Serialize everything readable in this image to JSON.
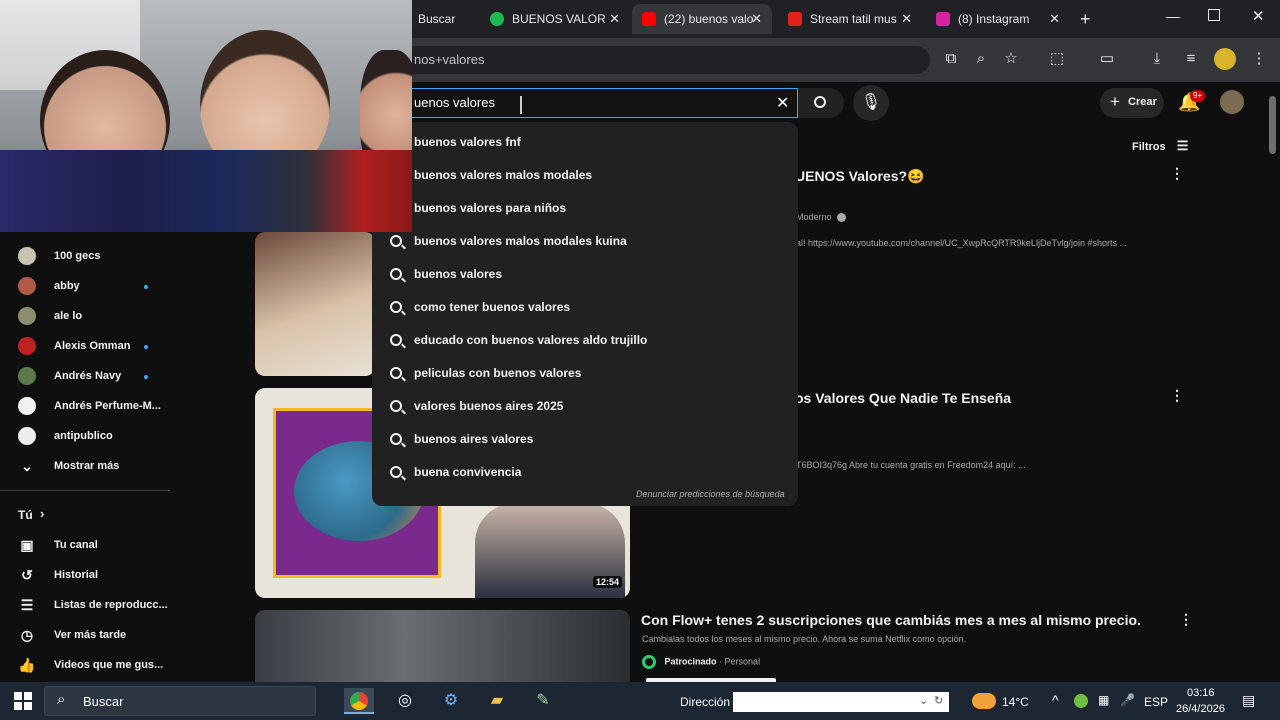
{
  "browser": {
    "tabs": [
      {
        "label": "Buscar",
        "color": "#4285f4"
      },
      {
        "label": "BUENOS VALOR",
        "color": "#1db954"
      },
      {
        "label": "(22) buenos valo",
        "color": "#ff0000"
      },
      {
        "label": "Stream tatil mus",
        "color": "#e62117"
      },
      {
        "label": "(8) Instagram",
        "color": "#d6249f"
      }
    ],
    "new_tab": "+",
    "address": "nos+valores",
    "window_controls": [
      "minimize",
      "maximize",
      "close"
    ]
  },
  "youtube": {
    "search_value": "uenos valores",
    "suggestions": [
      "buenos valores fnf",
      "buenos valores malos modales",
      "buenos valores para niños",
      "buenos valores malos modales kuina",
      "buenos valores",
      "como tener buenos valores",
      "educado con buenos valores aldo trujillo",
      "peliculas con buenos valores",
      "valores buenos aires 2025",
      "buenos aires valores",
      "buena convivencia"
    ],
    "report_text": "Denunciar predicciones de búsqueda",
    "create_label": "Crear",
    "notif_badge": "9+",
    "filters_label": "Filtros"
  },
  "sidebar": {
    "subscriptions": [
      {
        "name": "100 gecs",
        "color": "#c9c3b0",
        "dot": false
      },
      {
        "name": "abby",
        "color": "#b05a46",
        "dot": true
      },
      {
        "name": "ale lo",
        "color": "#8c8f6e",
        "dot": false
      },
      {
        "name": "Alexis Omman",
        "color": "#c02020",
        "dot": true
      },
      {
        "name": "Andrés Navy",
        "color": "#5b7a4a",
        "dot": true
      },
      {
        "name": "Andrés Perfume-M...",
        "color": "#f1f1f1",
        "dot": false
      },
      {
        "name": "antipublico",
        "color": "#eeeeee",
        "dot": false
      }
    ],
    "show_more": "Mostrar más",
    "you_section": "Tú",
    "you_items": [
      {
        "label": "Tu canal",
        "icon": "user-square-icon"
      },
      {
        "label": "Historial",
        "icon": "history-icon"
      },
      {
        "label": "Listas de reproducc...",
        "icon": "playlist-icon"
      },
      {
        "label": "Ver más tarde",
        "icon": "clock-icon"
      },
      {
        "label": "Videos que me gus...",
        "icon": "thumbs-up-icon"
      }
    ]
  },
  "results": [
    {
      "title": "UENOS Valores?😆",
      "channel": "Moderno",
      "desc": "al! https://www.youtube.com/channel/UC_XwpRcQRTR9keLljDeTvlg/join #shorts ..."
    },
    {
      "title": "os Valores Que Nadie Te Enseña",
      "desc": "T6BOI3q76g Abre tu cuenta gratis en Freedom24 aquí: ...",
      "duration": "12:54"
    },
    {
      "title": "Con Flow+ tenes 2 suscripciones que cambiás mes a mes al mismo precio.",
      "desc": "Cambialas todos los meses al mismo precio. Ahora se suma Netflix como opción.",
      "sponsor": "Patrocinado",
      "sponsor_type": "· Personal"
    }
  ],
  "taskbar": {
    "search_placeholder": "Buscar",
    "address_label": "Dirección",
    "temperature": "14°C",
    "language": "ESP",
    "time": "03:16",
    "date": "26/4/2026"
  }
}
